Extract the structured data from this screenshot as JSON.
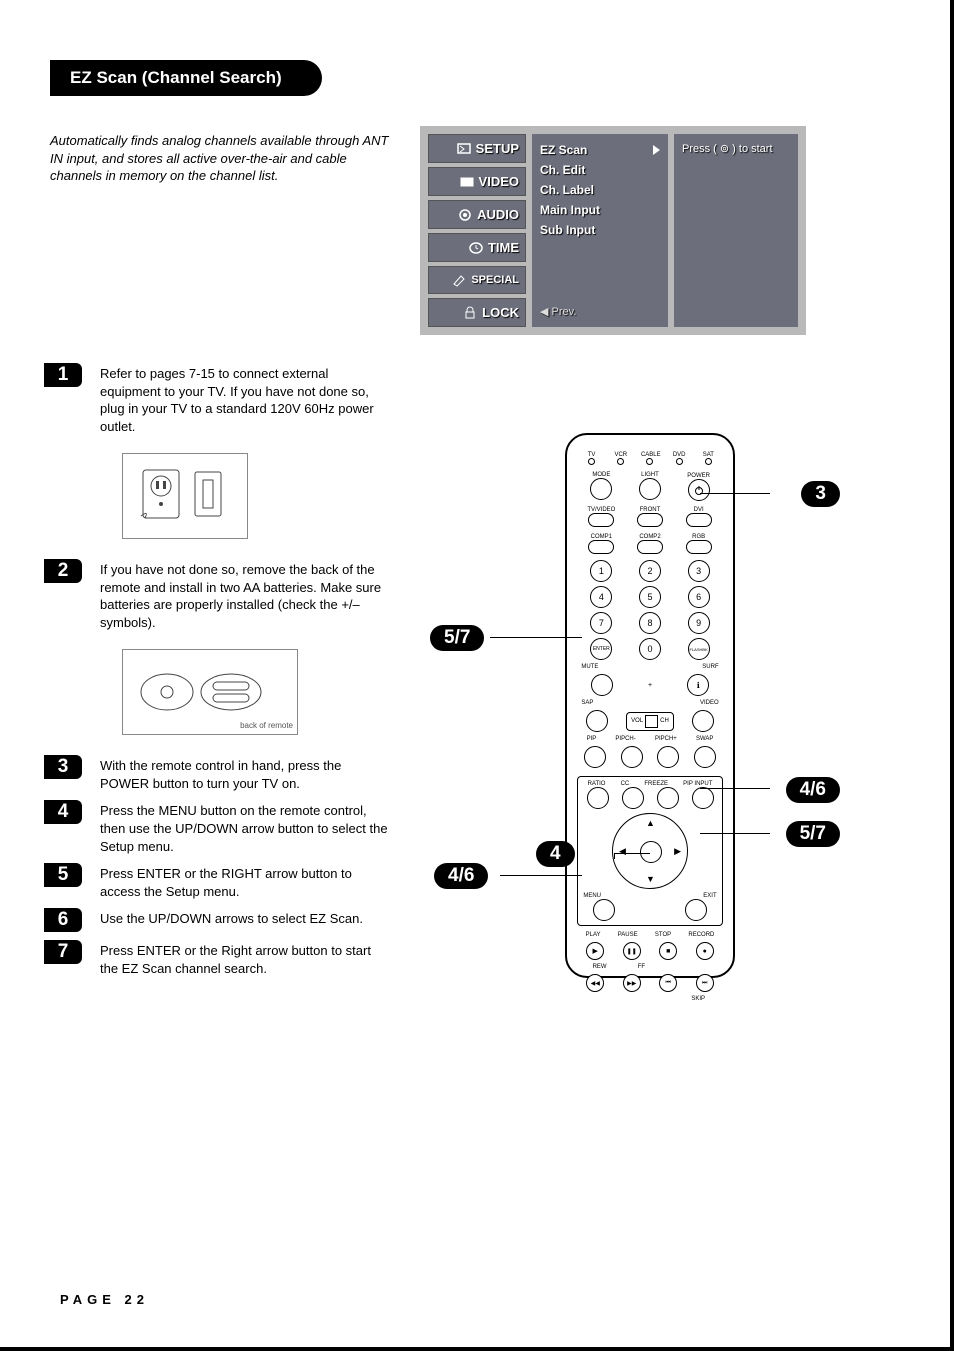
{
  "title": "EZ Scan (Channel Search)",
  "intro": "Automatically finds analog channels available through ANT IN input, and stores all active over-the-air and cable channels in memory on the channel list.",
  "osd": {
    "tabs": [
      "SETUP",
      "VIDEO",
      "AUDIO",
      "TIME",
      "SPECIAL",
      "LOCK"
    ],
    "items": [
      "EZ Scan",
      "Ch. Edit",
      "Ch. Label",
      "Main Input",
      "Sub Input"
    ],
    "prev": "◀ Prev.",
    "hint": "Press ( ⊚ ) to start"
  },
  "steps": [
    {
      "n": "1",
      "txt": "Refer to pages 7-15 to connect external equipment to your TV. If you have not done so, plug in your TV to a standard 120V 60Hz power outlet."
    },
    {
      "n": "2",
      "txt": "If you have not done so, remove the back of the remote and install in two AA batteries. Make sure batteries are properly installed (check the +/– symbols)."
    },
    {
      "n": "3",
      "txt": "With the remote control in hand, press the POWER button to turn your TV on."
    },
    {
      "n": "4",
      "txt": "Press the MENU button on the remote control, then use the UP/DOWN arrow button to select the Setup menu."
    },
    {
      "n": "5",
      "txt": "Press ENTER or the RIGHT arrow button to access the Setup menu."
    },
    {
      "n": "6",
      "txt": "Use the UP/DOWN arrows to select EZ Scan."
    },
    {
      "n": "7",
      "txt": "Press ENTER or the Right arrow button to start the EZ Scan channel search."
    }
  ],
  "illus2_caption": "back of remote",
  "remote": {
    "row1_lbls": [
      "TV",
      "VCR",
      "CABLE",
      "DVD",
      "SAT"
    ],
    "row2_lbls": [
      "MODE",
      "LIGHT",
      "POWER"
    ],
    "row3_lbls": [
      "TV/VIDEO",
      "FRONT",
      "DVI"
    ],
    "row4_lbls": [
      "COMP1",
      "COMP2",
      "RGB"
    ],
    "numpad": [
      [
        "1",
        "2",
        "3"
      ],
      [
        "4",
        "5",
        "6"
      ],
      [
        "7",
        "8",
        "9"
      ]
    ],
    "row_zero": [
      "ENTER",
      "0",
      "FLASHBK"
    ],
    "row_mute": [
      "MUTE",
      "SURF"
    ],
    "row_sap": [
      "SAP",
      "VIDEO"
    ],
    "volch": [
      "VOL",
      "CH"
    ],
    "row_pip": [
      "PIP",
      "PIPCH-",
      "PIPCH+",
      "SWAP"
    ],
    "row_ratio": [
      "RATIO",
      "CC",
      "FREEZE",
      "PIP INPUT"
    ],
    "nav": [
      "▲",
      "◀",
      "▶",
      "▼"
    ],
    "menu_exit": [
      "MENU",
      "EXIT"
    ],
    "transport1": [
      "PLAY",
      "PAUSE",
      "STOP",
      "RECORD"
    ],
    "transport1_sym": [
      "▶",
      "❚❚",
      "■",
      "●"
    ],
    "transport2_lbl": [
      "REW",
      "FF",
      "",
      ""
    ],
    "transport2_sym": [
      "◀◀",
      "▶▶",
      "⏮",
      "⏭"
    ],
    "skip": "SKIP"
  },
  "callouts": {
    "c_power": "3",
    "c_enter": "5/7",
    "c_menu_left": "4/6",
    "c_menu_mid": "4",
    "c_nav_right": "4/6",
    "c_nav_right2": "5/7"
  },
  "page_number": "PAGE 22"
}
